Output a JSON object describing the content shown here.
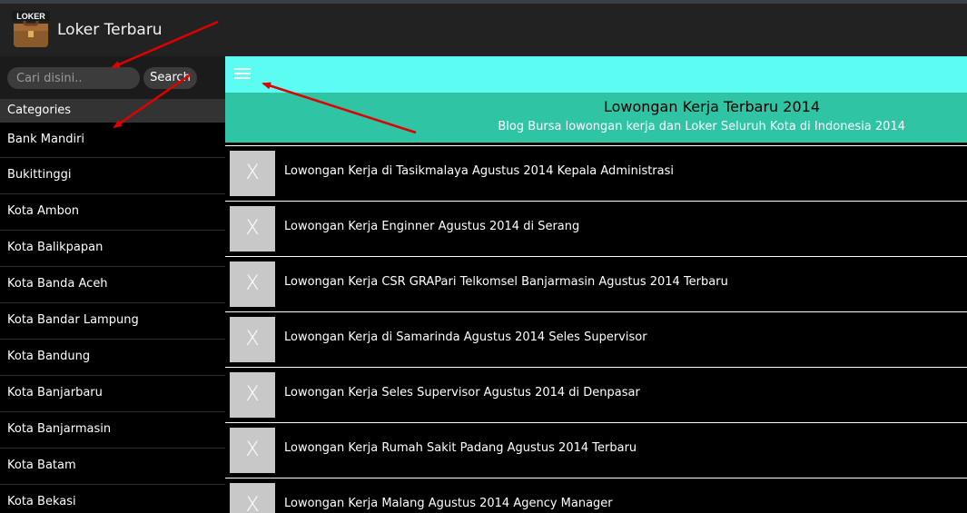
{
  "app": {
    "title": "Loker Terbaru",
    "logo_text": "LOKER"
  },
  "search": {
    "placeholder": "Cari disini..",
    "button_label": "Search"
  },
  "sidebar": {
    "header": "Categories",
    "items": [
      {
        "label": "Bank Mandiri"
      },
      {
        "label": "Bukittinggi"
      },
      {
        "label": "Kota Ambon"
      },
      {
        "label": "Kota Balikpapan"
      },
      {
        "label": "Kota Banda Aceh"
      },
      {
        "label": "Kota Bandar Lampung"
      },
      {
        "label": "Kota Bandung"
      },
      {
        "label": "Kota Banjarbaru"
      },
      {
        "label": "Kota Banjarmasin"
      },
      {
        "label": "Kota Batam"
      },
      {
        "label": "Kota Bekasi"
      }
    ]
  },
  "blog": {
    "title": "Lowongan Kerja Terbaru 2014",
    "subtitle": "Blog Bursa lowongan kerja dan Loker Seluruh Kota di Indonesia 2014"
  },
  "posts": [
    {
      "thumb": "X",
      "title": "Lowongan Kerja di Tasikmalaya Agustus 2014 Kepala Administrasi"
    },
    {
      "thumb": "X",
      "title": "Lowongan Kerja Enginner Agustus 2014 di Serang"
    },
    {
      "thumb": "X",
      "title": "Lowongan Kerja CSR GRAPari Telkomsel Banjarmasin Agustus 2014 Terbaru"
    },
    {
      "thumb": "X",
      "title": "Lowongan Kerja di Samarinda Agustus 2014 Seles Supervisor"
    },
    {
      "thumb": "X",
      "title": "Lowongan Kerja Seles Supervisor Agustus 2014 di Denpasar"
    },
    {
      "thumb": "X",
      "title": "Lowongan Kerja Rumah Sakit Padang Agustus 2014 Terbaru"
    },
    {
      "thumb": "X",
      "title": "Lowongan Kerja Malang Agustus 2014 Agency Manager"
    }
  ],
  "colors": {
    "toolbar": "#5cfcf3",
    "header": "#2ec4a4",
    "annotation_arrow": "#e00000"
  },
  "icons": {
    "menu": "hamburger-menu-icon",
    "logo": "briefcase-icon"
  }
}
